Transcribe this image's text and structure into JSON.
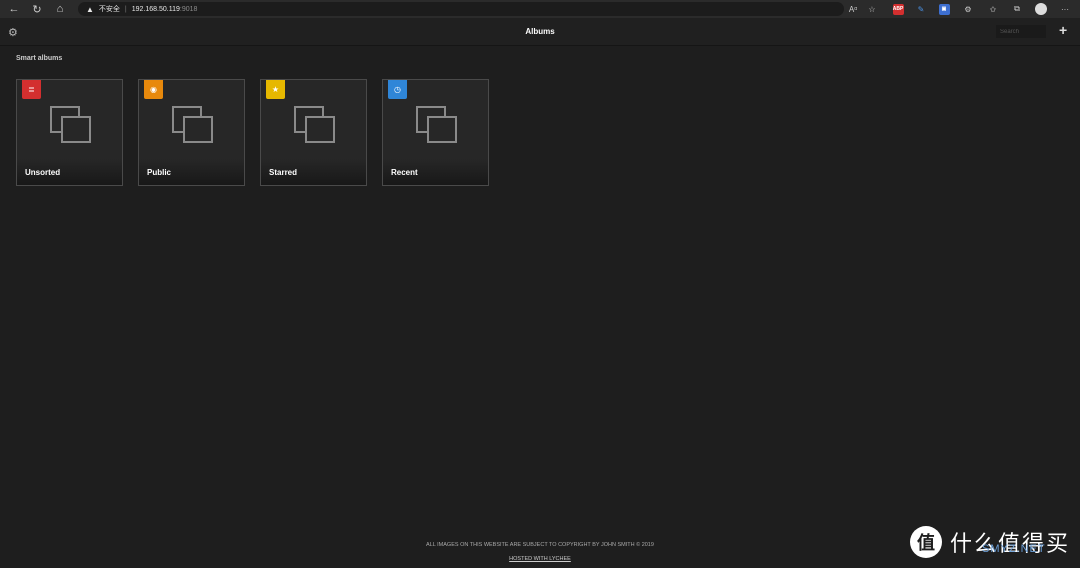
{
  "browser": {
    "insecure_label": "不安全",
    "separator": "|",
    "host": "192.168.50.119",
    "port": ":9018",
    "extensions": [
      "read-aloud-icon",
      "favorite-add-icon",
      "adblock-icon",
      "pen-icon",
      "tab-icon",
      "extension-icon",
      "favorites-icon",
      "collections-icon",
      "profile-avatar"
    ]
  },
  "header": {
    "title": "Albums",
    "search_placeholder": "Search"
  },
  "smart_albums": {
    "title": "Smart albums",
    "items": [
      {
        "label": "Unsorted",
        "badge_icon": "list-icon",
        "badge_color": "#d32f2f"
      },
      {
        "label": "Public",
        "badge_icon": "eye-icon",
        "badge_color": "#e8890c"
      },
      {
        "label": "Starred",
        "badge_icon": "star-icon",
        "badge_color": "#e6b800"
      },
      {
        "label": "Recent",
        "badge_icon": "clock-icon",
        "badge_color": "#2f86d8"
      }
    ]
  },
  "footer": {
    "copyright": "ALL IMAGES ON THIS WEBSITE ARE SUBJECT TO COPYRIGHT BY JOHN SMITH © 2019",
    "hosted": "HOSTED WITH LYCHEE"
  },
  "watermark": {
    "logo": "值",
    "text": "什么值得买",
    "sub": "SMYZ.NET"
  }
}
